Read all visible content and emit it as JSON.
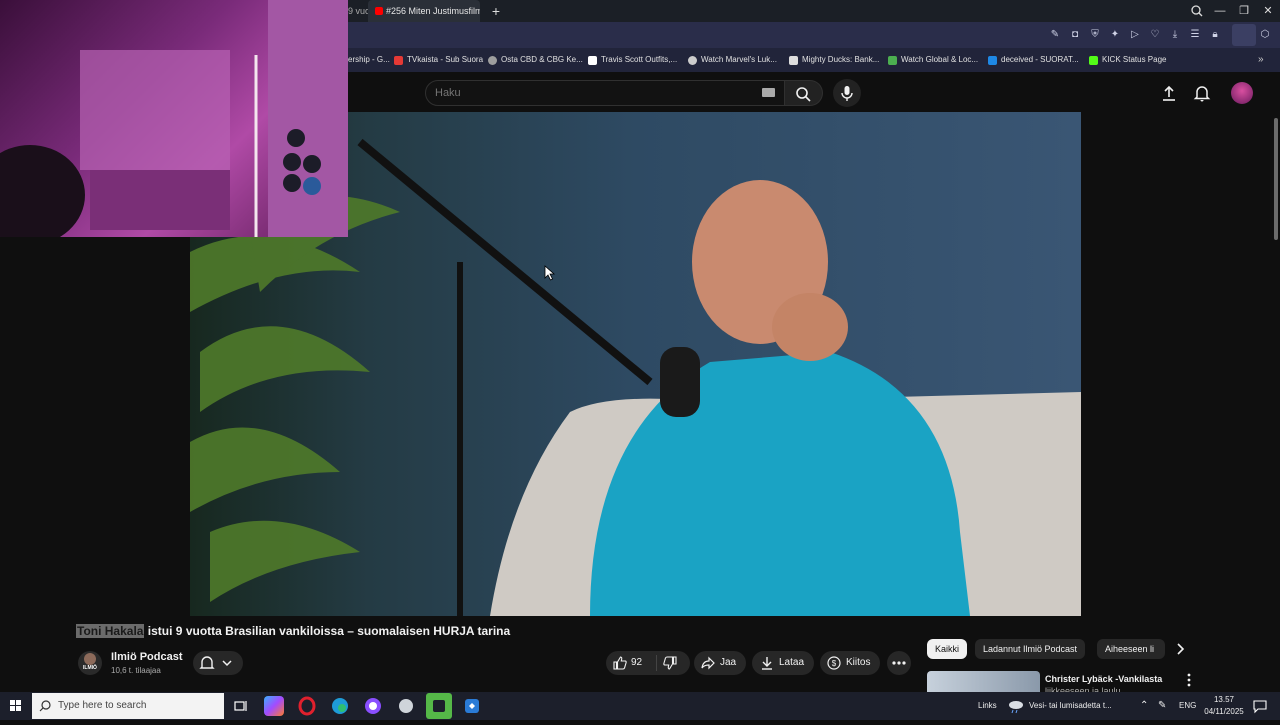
{
  "browser": {
    "tabs": [
      {
        "label": "9 vuo"
      },
      {
        "label": "#256 Miten Justimusfilm..."
      }
    ],
    "new_tab": "+",
    "window_controls": {
      "minimize": "—",
      "restore": "❐",
      "close": "✕"
    }
  },
  "bookmarks": [
    {
      "label": "ership - G...",
      "color": "#888888"
    },
    {
      "label": "TVkaista - Sub Suora",
      "color": "#e53935"
    },
    {
      "label": "Osta CBD & CBG Ke...",
      "color": "#9e9e9e"
    },
    {
      "label": "Travis Scott Outfits,...",
      "color": "#ffffff"
    },
    {
      "label": "Watch Marvel's Luk...",
      "color": "#cccccc"
    },
    {
      "label": "Mighty Ducks: Bank...",
      "color": "#dddddd"
    },
    {
      "label": "Watch Global & Loc...",
      "color": "#4caf50"
    },
    {
      "label": "deceived - SUORAT...",
      "color": "#1e88e5"
    },
    {
      "label": "KICK Status Page",
      "color": "#53fc18"
    }
  ],
  "youtube": {
    "search": {
      "placeholder": "Haku"
    },
    "video": {
      "title_highlight": "Toni Hakala",
      "title_rest": " istui 9 vuotta Brasilian vankiloissa – suomalaisen HURJA tarina"
    },
    "channel": {
      "name": "Ilmiö Podcast",
      "subscribers": "10,6 t. tilaajaa",
      "avatar_text": "ILMIÖ"
    },
    "actions": {
      "likes": "92",
      "share": "Jaa",
      "download": "Lataa",
      "thanks": "Kiitos"
    },
    "chips": [
      "Kaikki",
      "Ladannut Ilmiö Podcast",
      "Aiheeseen li"
    ],
    "recommendation": {
      "title": "Christer Lybäck -Vankilasta",
      "subtitle": "liikkeeseen ja laulu..."
    }
  },
  "taskbar": {
    "search_placeholder": "Type here to search",
    "links": "Links",
    "weather": "Vesi- tai lumisadetta t...",
    "language": "ENG",
    "time": "13.57",
    "date": "04/11/2025"
  },
  "colors": {
    "accent": "#ff0000",
    "background": "#0f0f0f",
    "pill": "#272727"
  }
}
